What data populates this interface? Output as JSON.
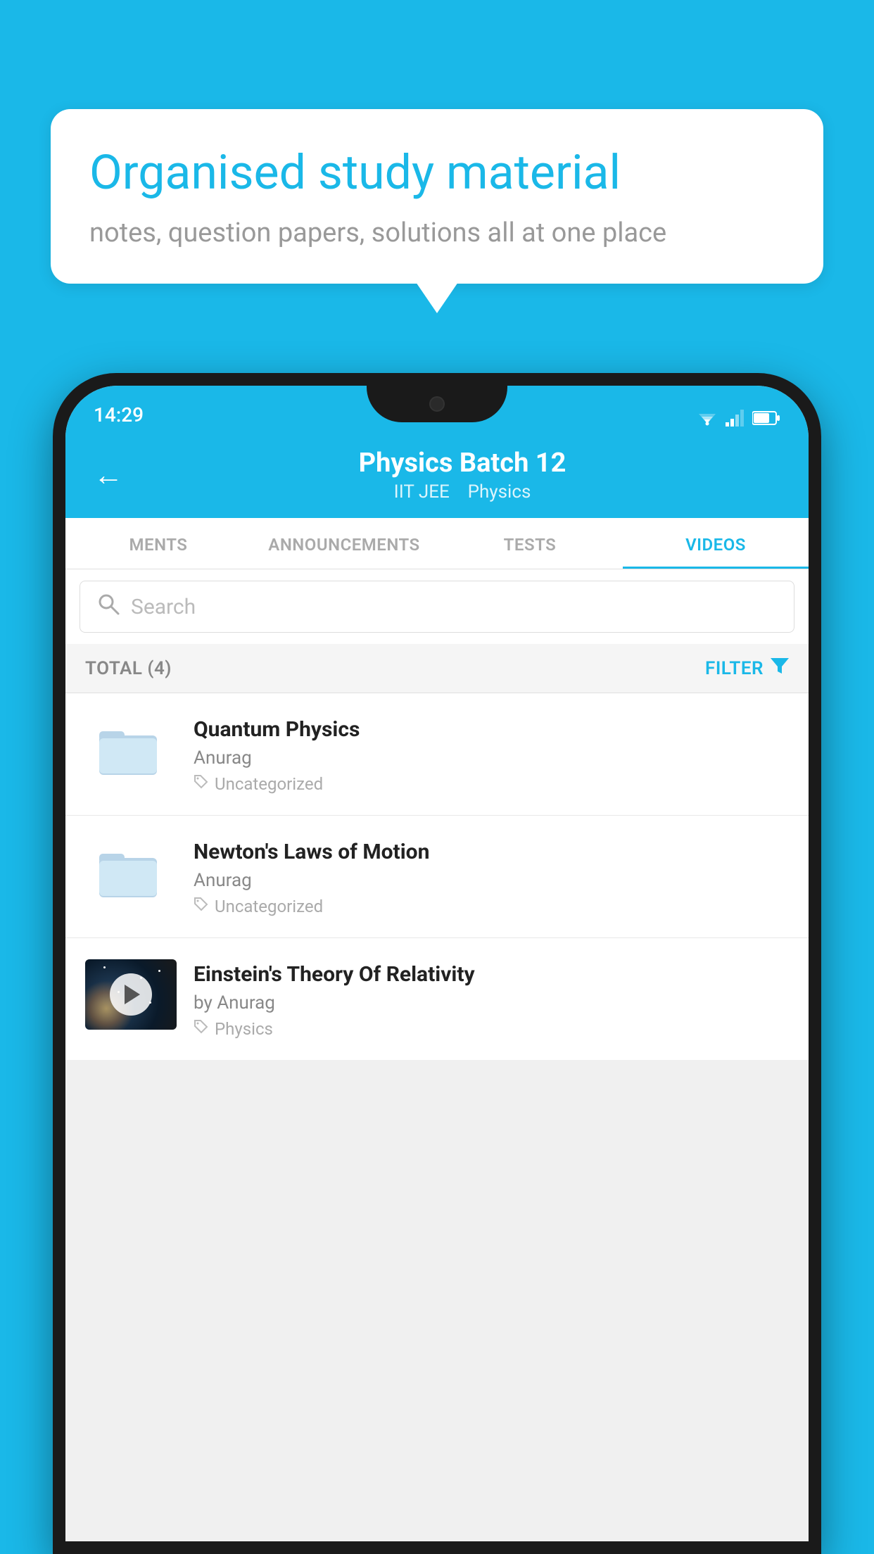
{
  "background_color": "#1ab8e8",
  "speech_bubble": {
    "title": "Organised study material",
    "subtitle": "notes, question papers, solutions all at one place"
  },
  "status_bar": {
    "time": "14:29"
  },
  "app_header": {
    "title": "Physics Batch 12",
    "subtitle_1": "IIT JEE",
    "subtitle_2": "Physics",
    "back_label": "←"
  },
  "tabs": [
    {
      "label": "MENTS",
      "active": false
    },
    {
      "label": "ANNOUNCEMENTS",
      "active": false
    },
    {
      "label": "TESTS",
      "active": false
    },
    {
      "label": "VIDEOS",
      "active": true
    }
  ],
  "search": {
    "placeholder": "Search"
  },
  "filter_bar": {
    "total_label": "TOTAL (4)",
    "filter_label": "FILTER"
  },
  "videos": [
    {
      "title": "Quantum Physics",
      "author": "Anurag",
      "tag": "Uncategorized",
      "type": "folder"
    },
    {
      "title": "Newton's Laws of Motion",
      "author": "Anurag",
      "tag": "Uncategorized",
      "type": "folder"
    },
    {
      "title": "Einstein's Theory Of Relativity",
      "author": "by Anurag",
      "tag": "Physics",
      "type": "video"
    }
  ]
}
